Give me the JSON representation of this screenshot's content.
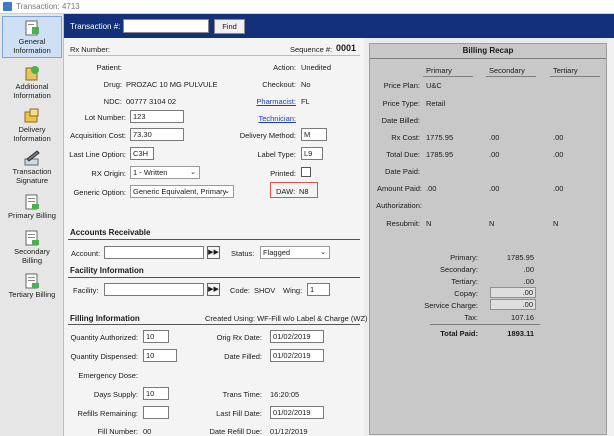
{
  "window": {
    "title": "Transaction: 4713"
  },
  "sidebar": [
    {
      "line1": "General",
      "line2": "Information"
    },
    {
      "line1": "Additional",
      "line2": "Information"
    },
    {
      "line1": "Delivery",
      "line2": "Information"
    },
    {
      "line1": "Transaction",
      "line2": "Signature"
    },
    {
      "line1": "Primary Billing",
      "line2": ""
    },
    {
      "line1": "Secondary",
      "line2": "Billing"
    },
    {
      "line1": "Tertiary Billing",
      "line2": ""
    }
  ],
  "topbar": {
    "transaction_label": "Transaction #:",
    "transaction_value": "",
    "find_label": "Find"
  },
  "general": {
    "rx_number_label": "Rx Number:",
    "sequence_label": "Sequence #:",
    "sequence_value": "0001",
    "patient_label": "Patient:",
    "patient_value": "",
    "action_label": "Action:",
    "action_value": "Unedited",
    "drug_label": "Drug:",
    "drug_value": "PROZAC 10 MG PULVULE",
    "checkout_label": "Checkout:",
    "checkout_value": "No",
    "ndc_label": "NDC:",
    "ndc_value": "00777 3104 02",
    "pharmacist_label": "Pharmacist:",
    "pharmacist_value": "FL",
    "technician_label": "Technician:",
    "lot_label": "Lot Number:",
    "lot_value": "123",
    "acq_label": "Acquisition Cost:",
    "acq_value": "73.30",
    "delivery_label": "Delivery Method:",
    "delivery_value": "M",
    "last_line_label": "Last Line Option:",
    "last_line_value": "C3H",
    "label_type_label": "Label Type:",
    "label_type_value": "L9",
    "rx_origin_label": "RX Origin:",
    "rx_origin_value": "1 - Written",
    "printed_label": "Printed:",
    "generic_label": "Generic Option:",
    "generic_value": "Generic Equivalent, Primary",
    "daw_label": "DAW:",
    "daw_value": "N8"
  },
  "ar": {
    "title": "Accounts Receivable",
    "account_label": "Account:",
    "status_label": "Status:",
    "status_value": "Flagged"
  },
  "facility": {
    "title": "Facility Information",
    "facility_label": "Facility:",
    "code_label": "Code:",
    "code_value": "SHOV",
    "wing_label": "Wing:",
    "wing_value": "1"
  },
  "filling": {
    "title": "Filling Information",
    "created_using": "Created Using: WF-Fill w/o Label & Charge (WZ)",
    "qty_auth_label": "Quantity Authorized:",
    "qty_auth_value": "10",
    "orig_rx_date_label": "Orig Rx Date:",
    "orig_rx_date_value": "01/02/2019",
    "qty_disp_label": "Quantity Dispensed:",
    "qty_disp_value": "10",
    "date_filled_label": "Date Filled:",
    "date_filled_value": "01/02/2019",
    "emergency_label": "Emergency Dose:",
    "days_supply_label": "Days Supply:",
    "days_supply_value": "10",
    "trans_time_label": "Trans Time:",
    "trans_time_value": "16:20:05",
    "refills_label": "Refills Remaining:",
    "refills_value": "",
    "last_fill_label": "Last Fill Date:",
    "last_fill_value": "01/02/2019",
    "fill_number_label": "Fill Number:",
    "fill_number_value": "00",
    "date_refill_due_label": "Date Refill Due:",
    "date_refill_due_value": "01/12/2019"
  },
  "recap": {
    "title": "Billing Recap",
    "col_primary": "Primary",
    "col_secondary": "Secondary",
    "col_tertiary": "Tertiary",
    "price_plan_label": "Price Plan:",
    "price_plan_primary": "U&C",
    "price_type_label": "Price Type:",
    "price_type_primary": "Retail",
    "date_billed_label": "Date Billed:",
    "rx_cost_label": "Rx Cost:",
    "rx_cost_primary": "1775.95",
    "rx_cost_secondary": ".00",
    "rx_cost_tertiary": ".00",
    "total_due_label": "Total Due:",
    "total_due_primary": "1785.95",
    "total_due_secondary": ".00",
    "total_due_tertiary": ".00",
    "date_paid_label": "Date Paid:",
    "amount_paid_label": "Amount Paid:",
    "amount_paid_primary": ".00",
    "amount_paid_secondary": ".00",
    "amount_paid_tertiary": ".00",
    "authorization_label": "Authorization:",
    "resubmit_label": "Resubmit:",
    "resubmit_primary": "N",
    "resubmit_secondary": "N",
    "resubmit_tertiary": "N",
    "sum_primary_label": "Primary:",
    "sum_primary_value": "1785.95",
    "sum_secondary_label": "Secondary:",
    "sum_secondary_value": ".00",
    "sum_tertiary_label": "Tertiary:",
    "sum_tertiary_value": ".00",
    "copay_label": "Copay:",
    "copay_value": ".00",
    "service_charge_label": "Service Charge:",
    "service_charge_value": ".00",
    "tax_label": "Tax:",
    "tax_value": "107.16",
    "total_paid_label": "Total Paid:",
    "total_paid_value": "1893.11"
  },
  "colors": {
    "topbar": "#13307a",
    "link": "#1c3fb0",
    "daw_border": "#d9534f",
    "recap_bg": "#c8c8c8"
  }
}
